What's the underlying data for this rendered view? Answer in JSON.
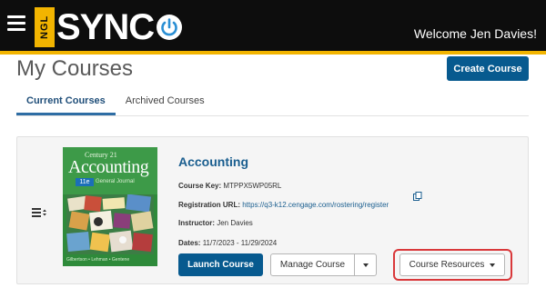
{
  "header": {
    "menu_icon": "hamburger-menu-icon",
    "logo": {
      "ngl": "NGL",
      "sync": "SYNC",
      "power_icon": "power-icon"
    },
    "welcome": "Welcome Jen Davies!"
  },
  "page": {
    "title": "My Courses",
    "create_button": "Create Course"
  },
  "tabs": [
    {
      "label": "Current Courses",
      "active": true
    },
    {
      "label": "Archived Courses",
      "active": false
    }
  ],
  "course": {
    "name": "Accounting",
    "cover": {
      "series": "Century 21",
      "title": "Accounting",
      "edition": "11e",
      "subtitle": "General Journal",
      "authors": "Gilbertson • Lehman • Gentene"
    },
    "key_label": "Course Key:",
    "key_value": "MTPPX5WP05RL",
    "url_label": "Registration URL:",
    "url_value": "https://q3-k12.cengage.com/rostering/register",
    "instructor_label": "Instructor:",
    "instructor_value": "Jen Davies",
    "dates_label": "Dates:",
    "dates_value": "11/7/2023 - 11/29/2024",
    "launch_button": "Launch Course",
    "manage_button": "Manage Course",
    "resources_button": "Course Resources"
  },
  "colors": {
    "header_bg": "#0d0d0d",
    "accent_yellow": "#f2b400",
    "primary_blue": "#075a8f",
    "link_blue": "#1a5e8f",
    "highlight_red": "#d9383a"
  }
}
